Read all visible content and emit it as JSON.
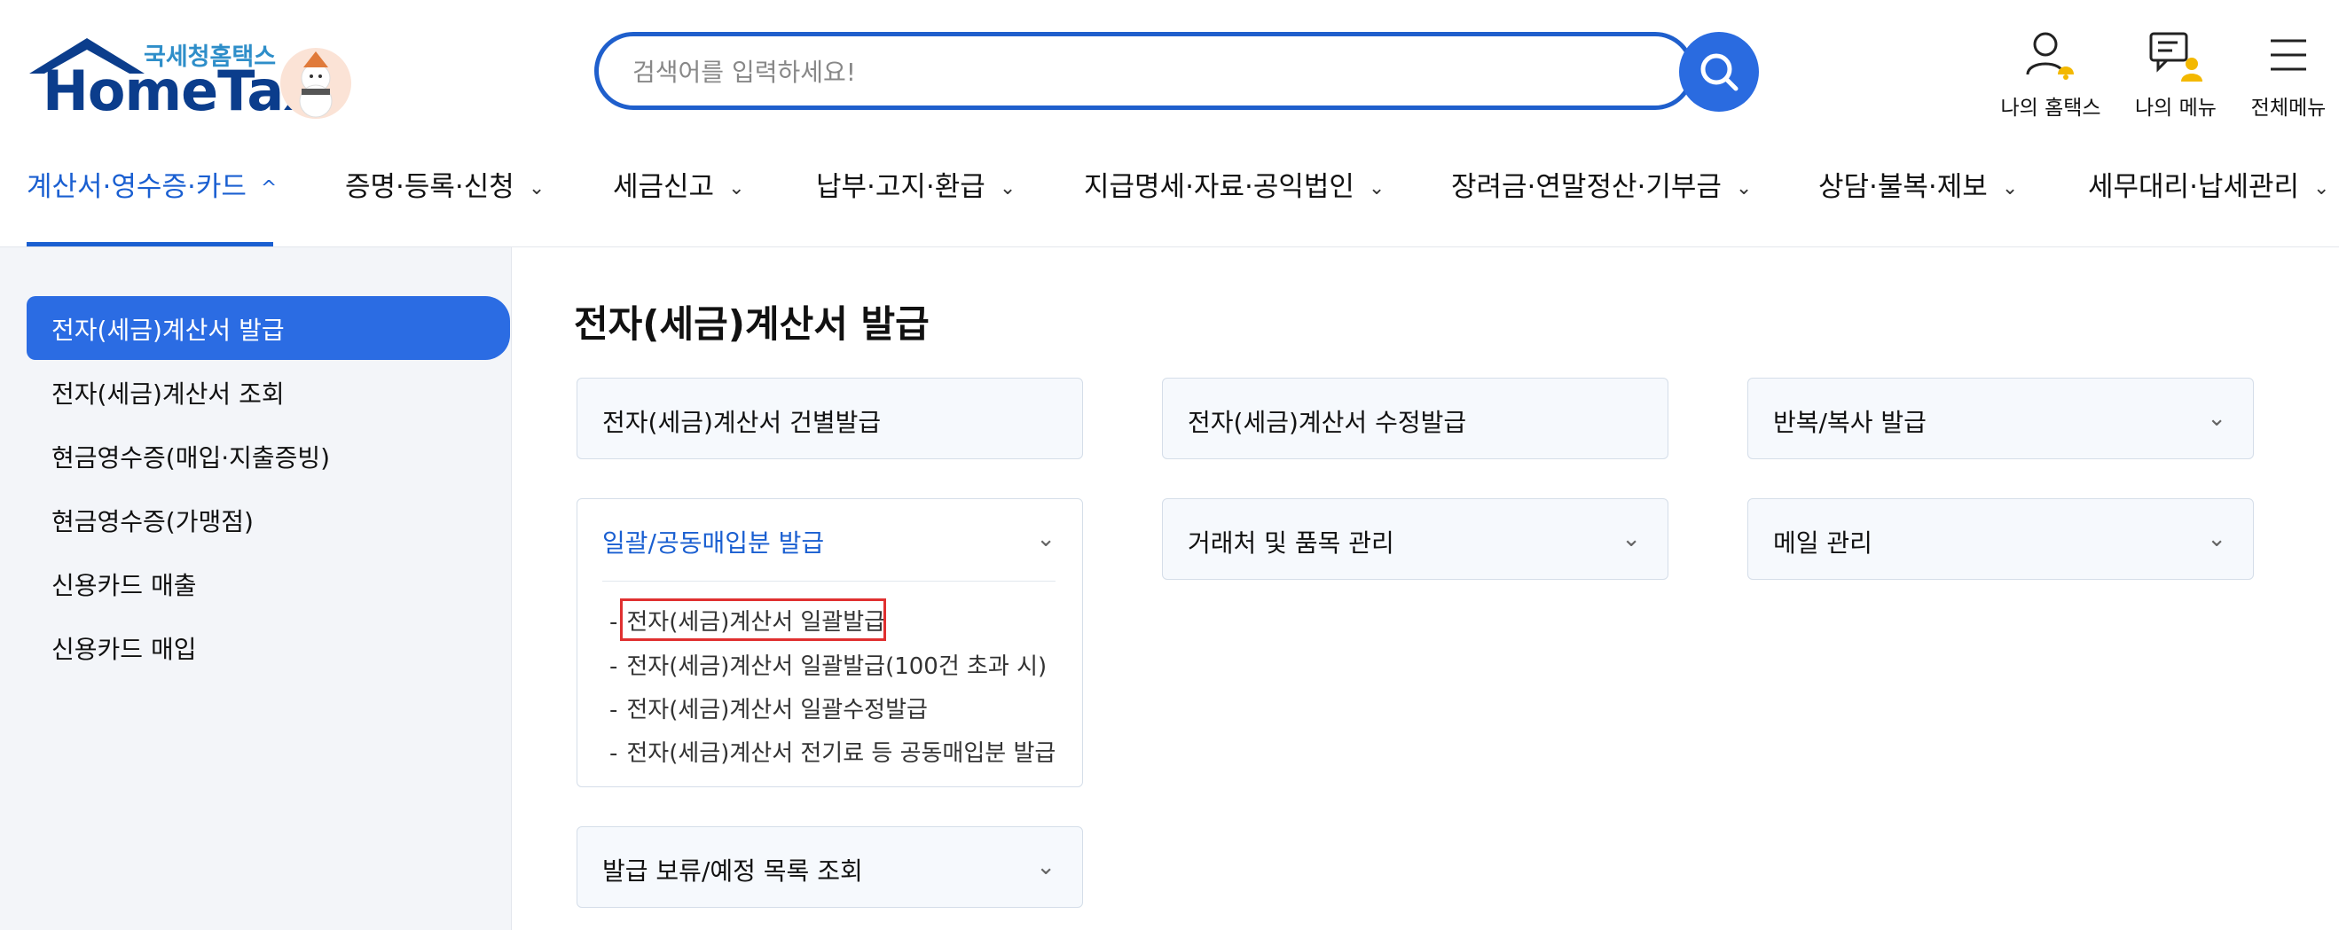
{
  "header": {
    "brand_kr": "국세청홈택스",
    "brand_en": "HomeTax",
    "search_placeholder": "검색어를 입력하세요!",
    "utils": [
      {
        "label": "나의 홈택스",
        "icon": "user-bell-icon"
      },
      {
        "label": "나의 메뉴",
        "icon": "chat-user-icon"
      },
      {
        "label": "전체메뉴",
        "icon": "hamburger-icon"
      }
    ]
  },
  "nav": {
    "items": [
      {
        "label": "계산서·영수증·카드",
        "chevron": "^"
      },
      {
        "label": "증명·등록·신청",
        "chevron": "⌄"
      },
      {
        "label": "세금신고",
        "chevron": "⌄"
      },
      {
        "label": "납부·고지·환급",
        "chevron": "⌄"
      },
      {
        "label": "지급명세·자료·공익법인",
        "chevron": "⌄"
      },
      {
        "label": "장려금·연말정산·기부금",
        "chevron": "⌄"
      },
      {
        "label": "상담·불복·제보",
        "chevron": "⌄"
      },
      {
        "label": "세무대리·납세관리",
        "chevron": "⌄"
      }
    ]
  },
  "sidebar": {
    "items": [
      {
        "label": "전자(세금)계산서 발급"
      },
      {
        "label": "전자(세금)계산서 조회"
      },
      {
        "label": "현금영수증(매입·지출증빙)"
      },
      {
        "label": "현금영수증(가맹점)"
      },
      {
        "label": "신용카드 매출"
      },
      {
        "label": "신용카드 매입"
      }
    ]
  },
  "main": {
    "title": "전자(세금)계산서 발급",
    "cards": [
      {
        "title": "전자(세금)계산서 건별발급"
      },
      {
        "title": "전자(세금)계산서 수정발급"
      },
      {
        "title": "반복/복사 발급"
      },
      {
        "title": "일괄/공동매입분 발급"
      },
      {
        "title": "거래처 및 품목 관리"
      },
      {
        "title": "메일 관리"
      },
      {
        "title": "발급 보류/예정 목록 조회"
      }
    ],
    "bulk_subitems": [
      {
        "label": "전자(세금)계산서 일괄발급"
      },
      {
        "label": "전자(세금)계산서 일괄발급(100건 초과 시)"
      },
      {
        "label": "전자(세금)계산서 일괄수정발급"
      },
      {
        "label": "전자(세금)계산서 전기료 등 공동매입분 발급"
      }
    ],
    "chevron": "⌄",
    "dash": "-"
  },
  "colors": {
    "primary": "#1a5fd1",
    "active_bg": "#2b6ce3",
    "highlight": "#e03030"
  }
}
